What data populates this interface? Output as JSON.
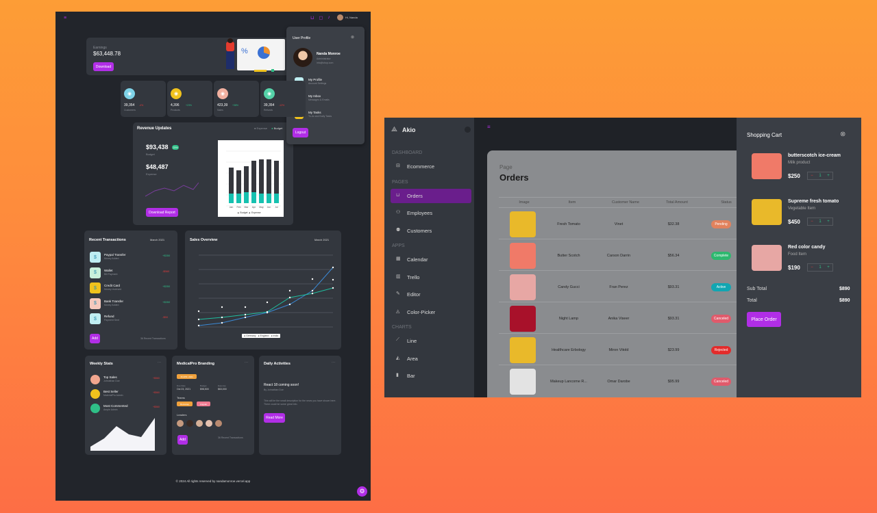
{
  "left_dashboard": {
    "top": {
      "user_name": "Hi, Nanda"
    },
    "earnings": {
      "label": "Earnings",
      "amount": "$63,448.78",
      "button": "Download"
    },
    "stats": [
      {
        "value": "39,354",
        "change": "-4%",
        "label": "Customers",
        "color": "#7fd3e8"
      },
      {
        "value": "4,396",
        "change": "+23%",
        "label": "Products",
        "color": "#f0c21d"
      },
      {
        "value": "423,39",
        "change": "+38%",
        "label": "Sales",
        "color": "#f1b0a0"
      },
      {
        "value": "39,354",
        "change": "-12%",
        "label": "Refunds",
        "color": "#55d2a8"
      }
    ],
    "revenue": {
      "title": "Revenue Updates",
      "legend_expense": "Expense",
      "legend_budget": "Budget",
      "budget_value": "$93,438",
      "budget_badge": "23%",
      "budget_label": "Budget",
      "expense_value": "$48,487",
      "expense_label": "Expense",
      "button": "Download Report",
      "months": [
        "Jan",
        "Feb",
        "Mar",
        "Apr",
        "May",
        "Jun",
        "Jul"
      ],
      "legend_bottom_budget": "Budget",
      "legend_bottom_expense": "Expense"
    },
    "profile": {
      "title": "User Profile",
      "name": "Nanda Monroe",
      "role": "Administrator",
      "email": "info@shop.com",
      "items": [
        {
          "title": "My Profile",
          "desc": "Account Settings",
          "color": "#bfeef2"
        },
        {
          "title": "My Inbox",
          "desc": "Messages & Emails",
          "color": "#c9f1dc"
        },
        {
          "title": "My Tasks",
          "desc": "To-do and Daily Tasks",
          "color": "#f0c21d"
        }
      ],
      "logout": "Logout"
    },
    "transactions": {
      "title": "Recent Transactions",
      "period": "March 2021",
      "items": [
        {
          "title": "Paypal Transfer",
          "desc": "Money Added",
          "amount": "+$350",
          "positive": true,
          "color": "#bfeef2"
        },
        {
          "title": "Wallet",
          "desc": "Bill Payment",
          "amount": "-$560",
          "positive": false,
          "color": "#c9f1dc"
        },
        {
          "title": "Credit Card",
          "desc": "Money reversed",
          "amount": "+$350",
          "positive": true,
          "color": "#f0c21d"
        },
        {
          "title": "Bank Transfer",
          "desc": "Money Added",
          "amount": "+$350",
          "positive": true,
          "color": "#f7c9bd"
        },
        {
          "title": "Refund",
          "desc": "Payment Sent",
          "amount": "-$50",
          "positive": false,
          "color": "#bfeef2"
        }
      ],
      "add": "Add",
      "footer": "36 Recent Transactions"
    },
    "sales": {
      "title": "Sales Overview",
      "period": "March 2021",
      "legend": [
        "Germany",
        "England",
        "India"
      ]
    },
    "weekly": {
      "title": "Weekly Stats",
      "items": [
        {
          "title": "Top Sales",
          "desc": "Johnathan Doe",
          "amount": "+$560",
          "color": "#f1a58e"
        },
        {
          "title": "Best Seller",
          "desc": "MaterialPro Admin",
          "amount": "+$560",
          "color": "#f0c21d"
        },
        {
          "title": "Most Commented",
          "desc": "Ample Admin",
          "amount": "+$560",
          "color": "#2fbf87"
        }
      ]
    },
    "medical": {
      "title": "MedicalPro Branding",
      "date_badge": "16 APR, 2021",
      "due_label": "Due Date",
      "due_value": "Oct 23, 2021",
      "budget_label": "Budget",
      "budget_value": "$98,500",
      "expense_label": "Expense",
      "expense_value": "$63,000",
      "teams_label": "Teams",
      "team1": "Bootstrap",
      "team2": "Angular",
      "leaders_label": "Leaders",
      "add": "Add",
      "footer": "36 Recent Transactions"
    },
    "daily": {
      "title": "Daily Activities",
      "headline": "React 18 coming soon!",
      "author": "By Johnathan Doe",
      "desc": "This will be the small description for the news you have shown here. There could be some great info.",
      "button": "Read More"
    },
    "footer": "© 2024 All rights reserved by nandamonroe.vercel.app"
  },
  "right_app": {
    "brand": "Akio",
    "sections": [
      {
        "heading": "DASHBOARD",
        "items": [
          {
            "label": "Ecommerce",
            "icon": "bag-icon"
          }
        ]
      },
      {
        "heading": "PAGES",
        "items": [
          {
            "label": "Orders",
            "icon": "cart-icon",
            "active": true
          },
          {
            "label": "Employees",
            "icon": "people-icon"
          },
          {
            "label": "Customers",
            "icon": "user-icon"
          }
        ]
      },
      {
        "heading": "APPS",
        "items": [
          {
            "label": "Calendar",
            "icon": "calendar-icon"
          },
          {
            "label": "Trello",
            "icon": "board-icon"
          },
          {
            "label": "Editor",
            "icon": "pen-icon"
          },
          {
            "label": "Color-Picker",
            "icon": "dropper-icon"
          }
        ]
      },
      {
        "heading": "CHARTS",
        "items": [
          {
            "label": "Line",
            "icon": "line-chart-icon"
          },
          {
            "label": "Area",
            "icon": "area-chart-icon"
          },
          {
            "label": "Bar",
            "icon": "bar-chart-icon"
          }
        ]
      }
    ],
    "orders": {
      "page_label": "Page",
      "title": "Orders",
      "columns": [
        "Image",
        "Item",
        "Customer Name",
        "Total Amount",
        "Status"
      ],
      "rows": [
        {
          "item": "Fresh Tomato",
          "customer": "Vinet",
          "amount": "$32.38",
          "status": "Pending",
          "status_color": "#e1825d",
          "img_color": "#e9b92a"
        },
        {
          "item": "Butter Scotch",
          "customer": "Carson Darrin",
          "amount": "$56.34",
          "status": "Complete",
          "status_color": "#2db86f",
          "img_color": "#f07a68"
        },
        {
          "item": "Candy Gucci",
          "customer": "Fran Perez",
          "amount": "$93.31",
          "status": "Active",
          "status_color": "#11a6b2",
          "img_color": "#e7a7a4"
        },
        {
          "item": "Night Lamp",
          "customer": "Anika Viseer",
          "amount": "$93.31",
          "status": "Canceled",
          "status_color": "#e05a6b",
          "img_color": "#a8112a"
        },
        {
          "item": "Healthcare Erbology",
          "customer": "Miron Vitold",
          "amount": "$23.99",
          "status": "Rejected",
          "status_color": "#e32b2b",
          "img_color": "#e9b92a"
        },
        {
          "item": "Makeup Lancome R...",
          "customer": "Omar Darobe",
          "amount": "$95.99",
          "status": "Canceled",
          "status_color": "#e05a6b",
          "img_color": "#e3e3e3"
        }
      ]
    },
    "cart": {
      "title": "Shopping Cart",
      "items": [
        {
          "name": "butterscotch ice-cream",
          "category": "Milk product",
          "price": "$250",
          "qty": "1",
          "img_color": "#f07a68"
        },
        {
          "name": "Supreme fresh tomato",
          "category": "Vegetable Item",
          "price": "$450",
          "qty": "1",
          "img_color": "#e9b92a"
        },
        {
          "name": "Red color candy",
          "category": "Food Item",
          "price": "$190",
          "qty": "1",
          "img_color": "#e7a7a4"
        }
      ],
      "subtotal_label": "Sub Total",
      "subtotal": "$890",
      "total_label": "Total",
      "total": "$890",
      "button": "Place Order"
    }
  }
}
